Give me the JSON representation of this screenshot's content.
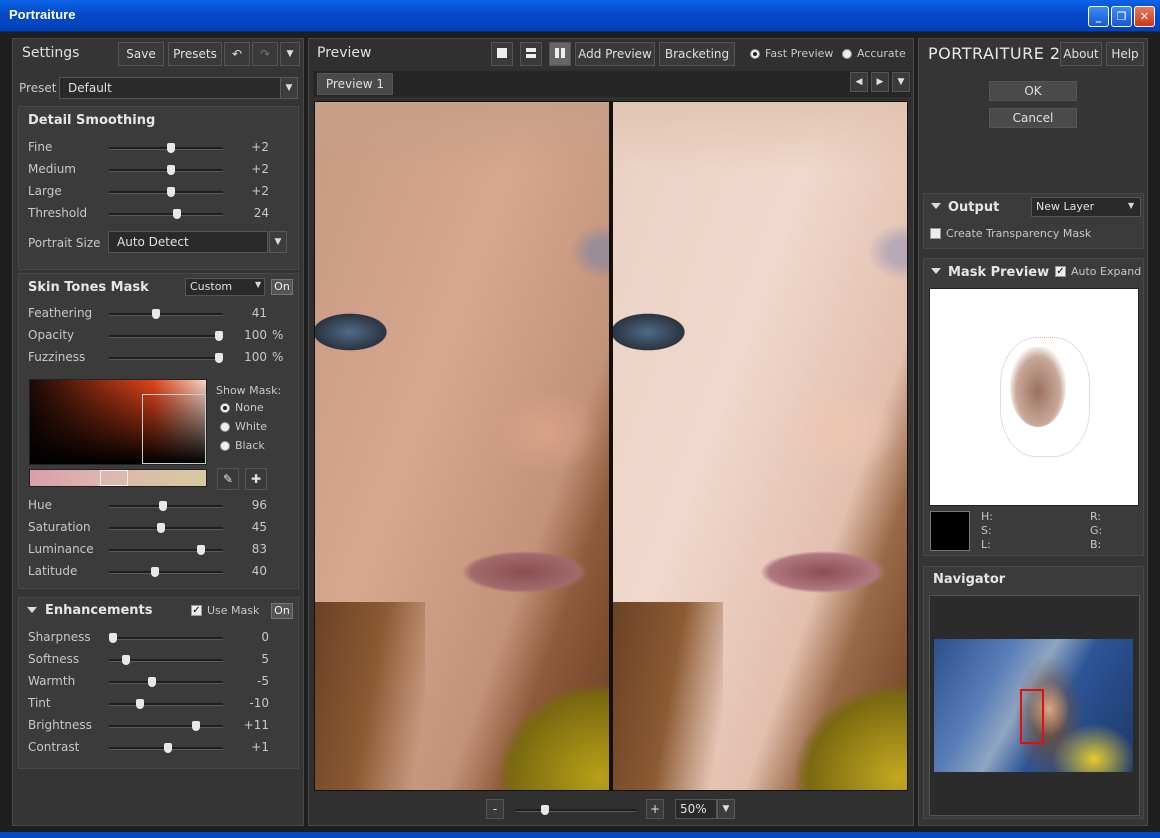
{
  "window": {
    "title": "Portraiture"
  },
  "settings": {
    "title": "Settings",
    "save": "Save",
    "presets": "Presets",
    "preset_label": "Preset",
    "preset_value": "Default"
  },
  "detail_smoothing": {
    "title": "Detail Smoothing",
    "rows": [
      {
        "label": "Fine",
        "value": "+2",
        "level": 0.55
      },
      {
        "label": "Medium",
        "value": "+2",
        "level": 0.55
      },
      {
        "label": "Large",
        "value": "+2",
        "level": 0.55
      },
      {
        "label": "Threshold",
        "value": "24",
        "level": 0.6
      }
    ],
    "portrait_size_label": "Portrait Size",
    "portrait_size_value": "Auto Detect"
  },
  "skin_tones": {
    "title": "Skin Tones Mask",
    "mode": "Custom",
    "on": "On",
    "rows": [
      {
        "label": "Feathering",
        "value": "41",
        "unit": "",
        "level": 0.41
      },
      {
        "label": "Opacity",
        "value": "100",
        "unit": "%",
        "level": 1.0
      },
      {
        "label": "Fuzziness",
        "value": "100",
        "unit": "%",
        "level": 1.0
      }
    ],
    "show_mask_label": "Show Mask:",
    "show_mask_options": [
      "None",
      "White",
      "Black"
    ],
    "show_mask_selected": "None",
    "hsl_rows": [
      {
        "label": "Hue",
        "value": "96",
        "level": 0.47
      },
      {
        "label": "Saturation",
        "value": "45",
        "level": 0.45
      },
      {
        "label": "Luminance",
        "value": "83",
        "level": 0.83
      },
      {
        "label": "Latitude",
        "value": "40",
        "level": 0.4
      }
    ]
  },
  "enhancements": {
    "title": "Enhancements",
    "use_mask": "Use Mask",
    "on": "On",
    "rows": [
      {
        "label": "Sharpness",
        "value": "0",
        "level": 0.0
      },
      {
        "label": "Softness",
        "value": "5",
        "level": 0.12
      },
      {
        "label": "Warmth",
        "value": "-5",
        "level": 0.37
      },
      {
        "label": "Tint",
        "value": "-10",
        "level": 0.25
      },
      {
        "label": "Brightness",
        "value": "+11",
        "level": 0.78
      },
      {
        "label": "Contrast",
        "value": "+1",
        "level": 0.52
      }
    ]
  },
  "preview": {
    "title": "Preview",
    "add_preview": "Add Preview",
    "bracketing": "Bracketing",
    "fast_preview": "Fast Preview",
    "accurate": "Accurate",
    "tab": "Preview 1",
    "zoom": "50%",
    "zoom_minus": "-",
    "zoom_plus": "+",
    "zoom_level": 0.22
  },
  "right": {
    "brand": "PORTRAITURE 2",
    "about": "About",
    "help": "Help",
    "ok": "OK",
    "cancel": "Cancel",
    "output_title": "Output",
    "output_value": "New Layer",
    "transparency_mask": "Create Transparency Mask",
    "mask_preview_title": "Mask Preview",
    "auto_expand": "Auto Expand",
    "h": "H:",
    "s": "S:",
    "l": "L:",
    "r": "R:",
    "g": "G:",
    "b": "B:",
    "navigator_title": "Navigator"
  },
  "icons": [
    "undo-icon",
    "redo-icon",
    "dropdown-arrow-icon",
    "single-view-icon",
    "split-horizontal-icon",
    "split-vertical-icon",
    "arrow-left-icon",
    "arrow-right-icon",
    "eyedropper-icon",
    "eyedropper-add-icon"
  ]
}
